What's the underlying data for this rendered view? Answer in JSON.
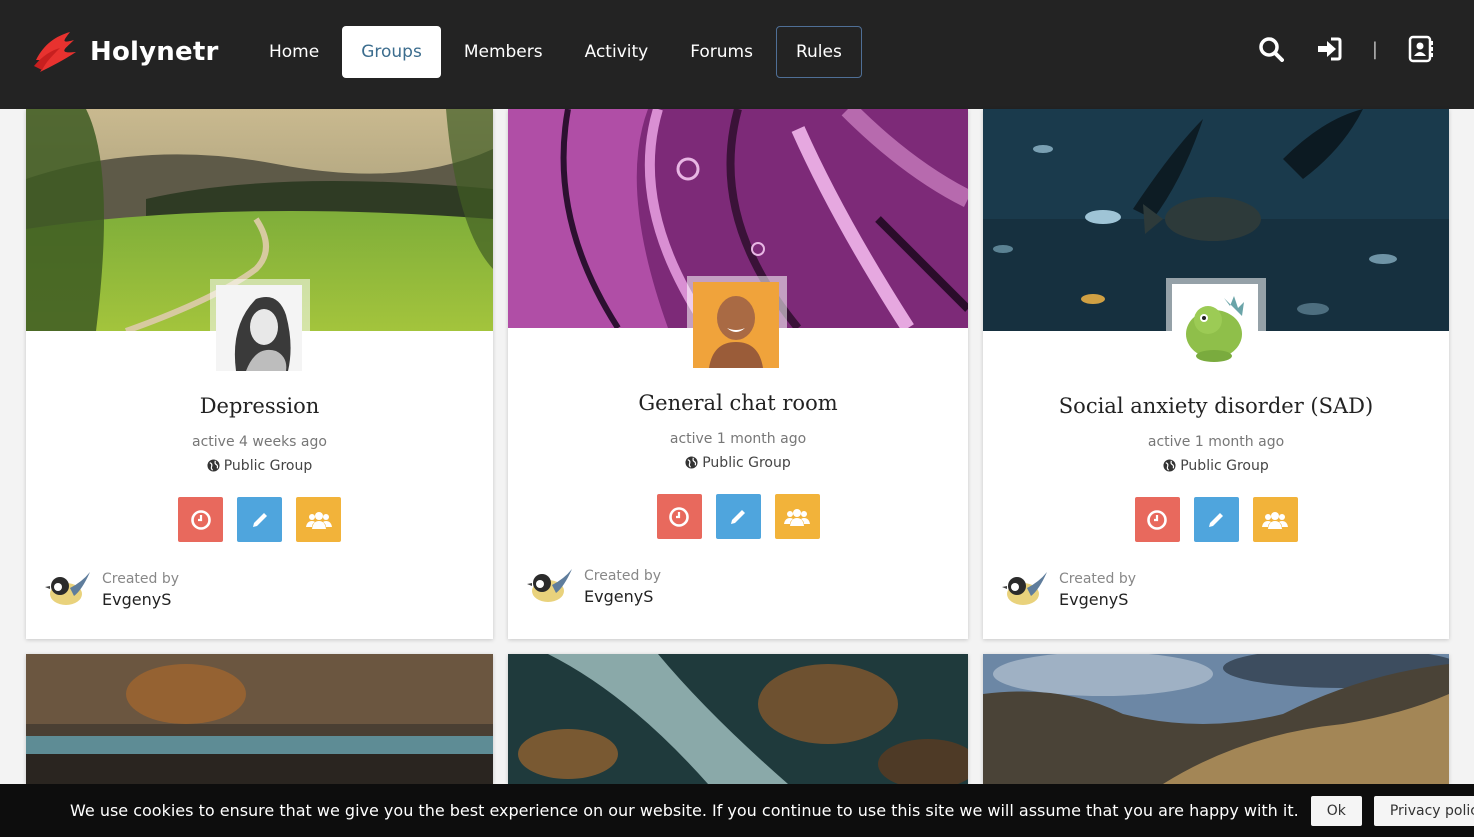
{
  "brand": {
    "name": "Holynetr",
    "accent": "#e8322f"
  },
  "nav": {
    "items": [
      {
        "label": "Home"
      },
      {
        "label": "Groups"
      },
      {
        "label": "Members"
      },
      {
        "label": "Activity"
      },
      {
        "label": "Forums"
      },
      {
        "label": "Rules"
      }
    ],
    "active": "Groups"
  },
  "header_icons": [
    "search-icon",
    "sign-in-icon",
    "address-book-icon"
  ],
  "groups": [
    {
      "title": "Depression",
      "active": "active 4 weeks ago",
      "type": "Public Group",
      "created_by_label": "Created by",
      "creator": "EvgenyS"
    },
    {
      "title": "General chat room",
      "active": "active 1 month ago",
      "type": "Public Group",
      "created_by_label": "Created by",
      "creator": "EvgenyS"
    },
    {
      "title": "Social anxiety disorder (SAD)",
      "active": "active 1 month ago",
      "type": "Public Group",
      "created_by_label": "Created by",
      "creator": "EvgenyS"
    }
  ],
  "action_colors": {
    "activity": "#e8695d",
    "edit": "#4fa5dd",
    "members": "#f2b33a"
  },
  "cookie": {
    "text": "We use cookies to ensure that we give you the best experience on our website. If you continue to use this site we will assume that you are happy with it.",
    "ok_label": "Ok",
    "privacy_label": "Privacy policy"
  }
}
